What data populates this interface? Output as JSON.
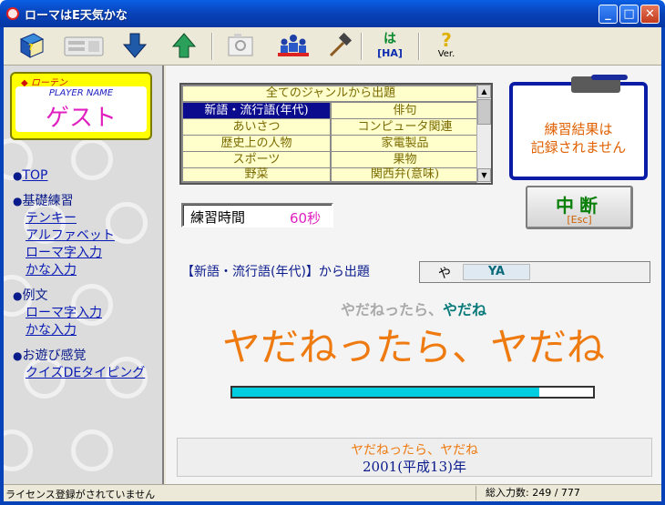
{
  "window": {
    "title": "ローマはE天気かな",
    "minimize": "_",
    "maximize": "□",
    "close": "✕"
  },
  "toolbar": {
    "items": [
      {
        "name": "book",
        "icon": "book-icon"
      },
      {
        "name": "keyboard",
        "icon": "keyboard-icon"
      },
      {
        "name": "down",
        "icon": "down-arrow-icon"
      },
      {
        "name": "up",
        "icon": "up-arrow-icon"
      },
      {
        "name": "screen",
        "icon": "screen-icon"
      },
      {
        "name": "people",
        "icon": "people-icon"
      },
      {
        "name": "hammer",
        "icon": "hammer-icon"
      }
    ],
    "ha_top": "は",
    "ha_bottom": "[HA]",
    "ver_label": "Ver."
  },
  "sidebar": {
    "brand": "ローテン",
    "player_label": "PLAYER NAME",
    "player_name": "ゲスト",
    "top_link": "TOP",
    "basic_head": "基礎練習",
    "basic_links": [
      "テンキー",
      "アルファベット",
      "ローマ字入力",
      "かな入力"
    ],
    "sentence_head": "例文",
    "sentence_links": [
      "ローマ字入力",
      "かな入力"
    ],
    "play_head": "お遊び感覚",
    "play_links": [
      "クイズDEタイピング"
    ]
  },
  "genre": {
    "all": "全てのジャンルから出題",
    "rows": [
      [
        "新語・流行語(年代)",
        "俳句"
      ],
      [
        "あいさつ",
        "コンピュータ関連"
      ],
      [
        "歴史上の人物",
        "家電製品"
      ],
      [
        "スポーツ",
        "果物"
      ],
      [
        "野菜",
        "関西弁(意味)"
      ]
    ],
    "selected": "新語・流行語(年代)"
  },
  "notice": {
    "line1": "練習結果は",
    "line2": "記録されません"
  },
  "stop_button": {
    "label": "中断",
    "key": "[Esc]"
  },
  "timer": {
    "label": "練習時間",
    "value": "60秒"
  },
  "question": {
    "label": "【新語・流行語(年代)】から出題",
    "kana": "や",
    "romaji": "YA"
  },
  "reading": {
    "typed": "やだねったら、",
    "rest": "やだね"
  },
  "big_text": "ヤだねったら、ヤだね",
  "progress": {
    "fraction": 0.85
  },
  "answer": {
    "line1": "ヤだねったら、ヤだね",
    "line2": "2001(平成13)年"
  },
  "status": {
    "left": "ライセンス登録がされていません",
    "right": "総入力数: 249 / 777"
  },
  "colors": {
    "titlebar": "#0842b8",
    "accent_orange": "#ee7a10",
    "navy": "#0a1b8c",
    "magenta": "#e020c0",
    "progress": "#00cde0"
  }
}
